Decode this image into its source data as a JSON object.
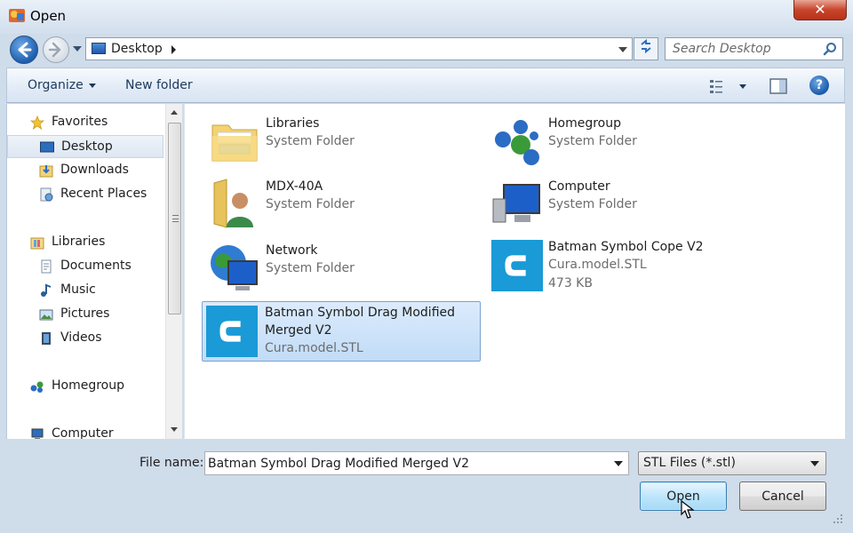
{
  "window": {
    "title": "Open",
    "close_label": "✕"
  },
  "address": {
    "location": "Desktop",
    "search_placeholder": "Search Desktop"
  },
  "toolbar": {
    "organize_label": "Organize",
    "new_folder_label": "New folder",
    "help_label": "?"
  },
  "navpane": {
    "items": [
      {
        "label": "Favorites",
        "icon": "star-icon"
      },
      {
        "label": "Desktop",
        "icon": "desktop-icon",
        "selected": true
      },
      {
        "label": "Downloads",
        "icon": "downloads-icon"
      },
      {
        "label": "Recent Places",
        "icon": "recent-places-icon"
      },
      {
        "label": "Libraries",
        "icon": "libraries-icon"
      },
      {
        "label": "Documents",
        "icon": "documents-icon"
      },
      {
        "label": "Music",
        "icon": "music-icon"
      },
      {
        "label": "Pictures",
        "icon": "pictures-icon"
      },
      {
        "label": "Videos",
        "icon": "videos-icon"
      },
      {
        "label": "Homegroup",
        "icon": "homegroup-icon"
      },
      {
        "label": "Computer",
        "icon": "computer-icon"
      }
    ]
  },
  "files": [
    {
      "name": "Libraries",
      "type": "System Folder",
      "icon": "libraries-folder-icon"
    },
    {
      "name": "Homegroup",
      "type": "System Folder",
      "icon": "homegroup-icon"
    },
    {
      "name": "MDX-40A",
      "type": "System Folder",
      "icon": "user-folder-icon"
    },
    {
      "name": "Computer",
      "type": "System Folder",
      "icon": "computer-icon"
    },
    {
      "name": "Network",
      "type": "System Folder",
      "icon": "network-icon"
    },
    {
      "name": "Batman Symbol Cope V2",
      "type": "Cura.model.STL",
      "size": "473 KB",
      "icon": "cura-icon"
    },
    {
      "name": "Batman Symbol Drag Modified Merged V2",
      "type": "Cura.model.STL",
      "icon": "cura-icon",
      "selected": true
    }
  ],
  "bottom": {
    "filename_label": "File name:",
    "filename_value": "Batman Symbol Drag Modified Merged V2",
    "filetype_value": "STL Files (*.stl)",
    "open_label": "Open",
    "cancel_label": "Cancel"
  },
  "colors": {
    "selection": "#cde5fb",
    "accent": "#1d5fad",
    "cura": "#1a9ad6"
  }
}
